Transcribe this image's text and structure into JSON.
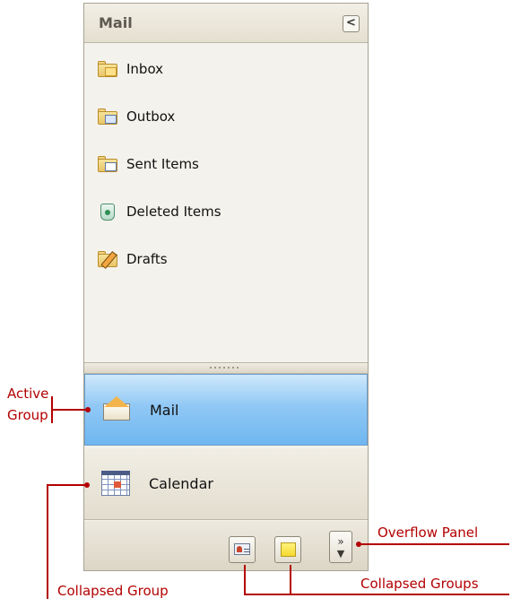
{
  "navbar": {
    "header": {
      "title": "Mail",
      "collapse_glyph": "<"
    },
    "items": [
      {
        "label": "Inbox",
        "icon": "inbox-folder-icon"
      },
      {
        "label": "Outbox",
        "icon": "outbox-folder-icon"
      },
      {
        "label": "Sent Items",
        "icon": "sent-folder-icon"
      },
      {
        "label": "Deleted Items",
        "icon": "recycle-bin-icon"
      },
      {
        "label": "Drafts",
        "icon": "drafts-folder-icon"
      }
    ],
    "groups": [
      {
        "label": "Mail",
        "icon": "mail-envelope-icon",
        "active": true
      },
      {
        "label": "Calendar",
        "icon": "calendar-icon",
        "active": false
      }
    ],
    "collapsed_groups": [
      {
        "icon": "contacts-icon"
      },
      {
        "icon": "notes-icon"
      }
    ],
    "overflow_glyph": "»"
  },
  "callouts": {
    "active_group_line1": "Active",
    "active_group_line2": "Group",
    "collapsed_group": "Collapsed Group",
    "overflow_panel": "Overflow Panel",
    "collapsed_groups": "Collapsed Groups"
  },
  "colors": {
    "callout": "#b30000",
    "active_group_blue": "#90c8f5",
    "panel_beige": "#f4f2ec"
  }
}
